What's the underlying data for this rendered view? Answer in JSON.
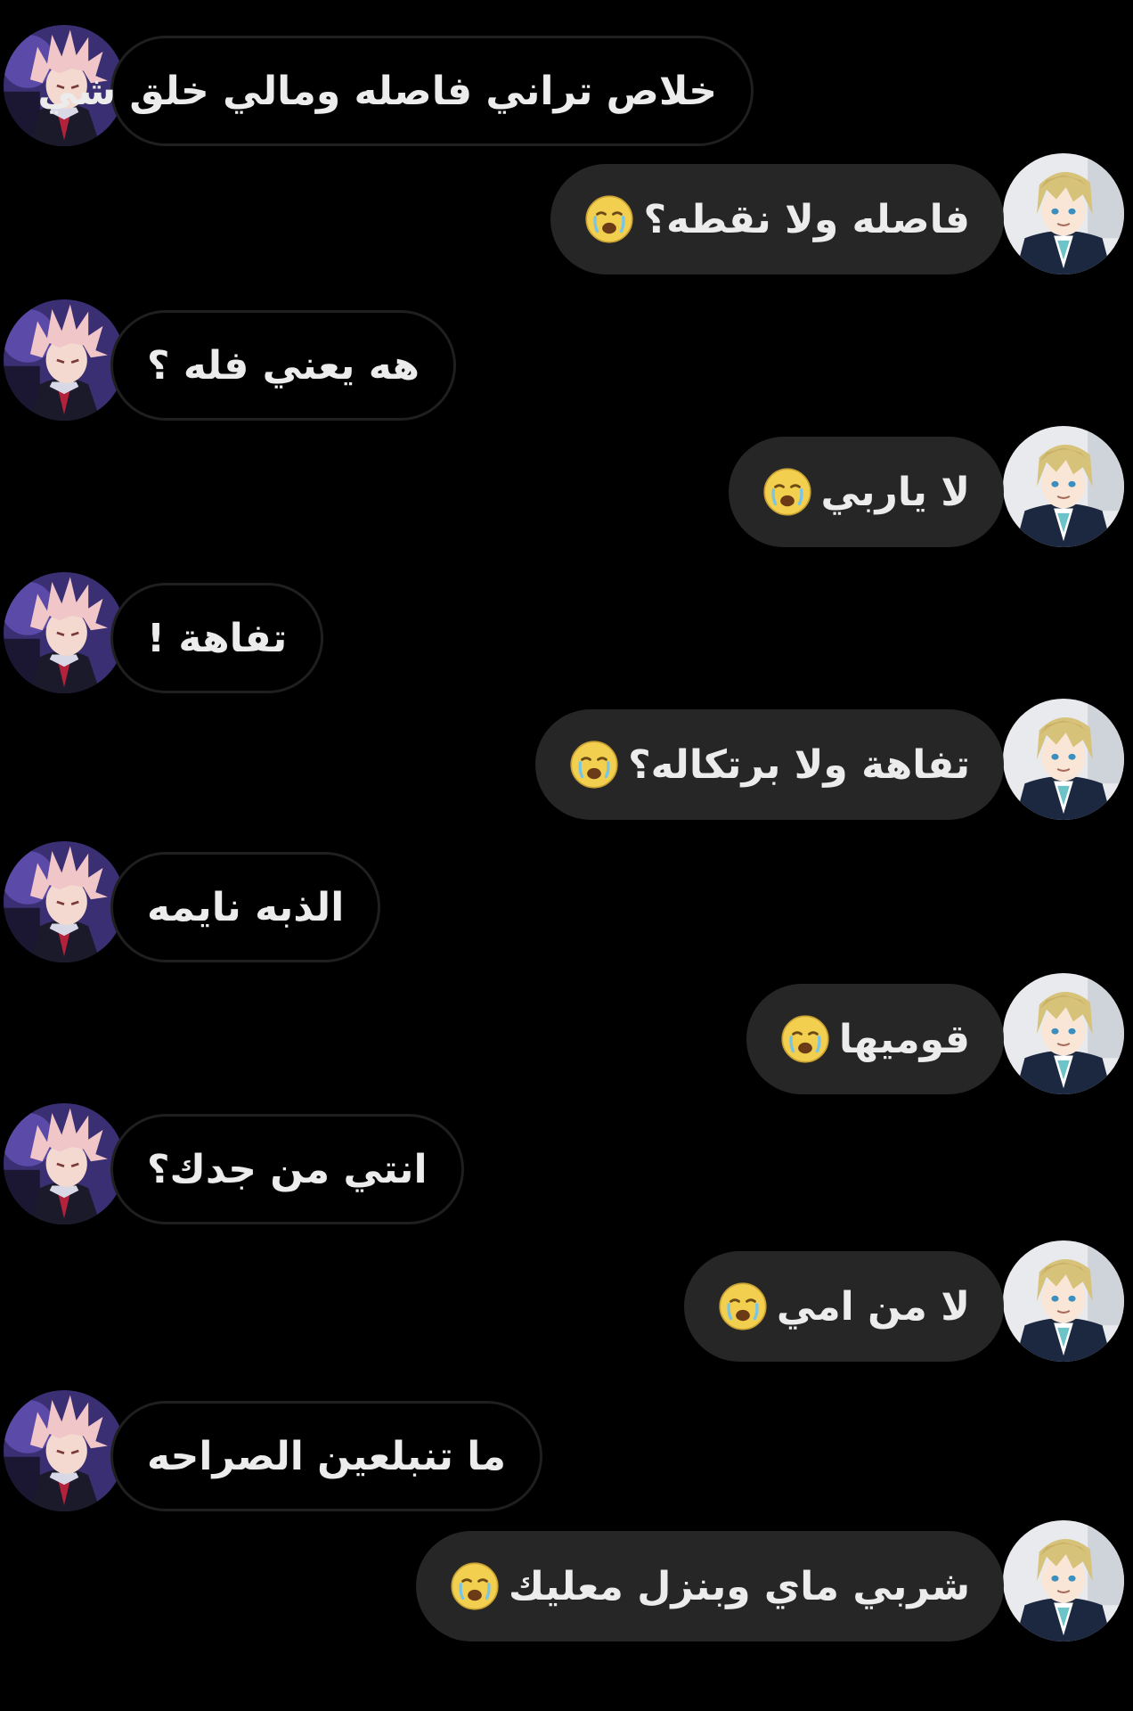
{
  "messages": [
    {
      "side": "in",
      "text": "خلاص تراني فاصله ومالي خلق شي",
      "emoji": null
    },
    {
      "side": "out",
      "text": "فاصله ولا نقطه؟",
      "emoji": "crying-face-emoji"
    },
    {
      "side": "in",
      "text": "هه يعني فله ؟",
      "emoji": null
    },
    {
      "side": "out",
      "text": "لا ياربي",
      "emoji": "crying-face-emoji"
    },
    {
      "side": "in",
      "text": "تفاهة !",
      "emoji": null
    },
    {
      "side": "out",
      "text": "تفاهة ولا برتكاله؟",
      "emoji": "crying-face-emoji"
    },
    {
      "side": "in",
      "text": "الذبه نايمه",
      "emoji": null
    },
    {
      "side": "out",
      "text": "قوميها",
      "emoji": "crying-face-emoji"
    },
    {
      "side": "in",
      "text": "انتي من جدك؟",
      "emoji": null
    },
    {
      "side": "out",
      "text": "لا من امي",
      "emoji": "crying-face-emoji"
    },
    {
      "side": "in",
      "text": "ما تنبلعين الصراحه",
      "emoji": null
    },
    {
      "side": "out",
      "text": "شربي ماي وبنزل معليك",
      "emoji": "crying-face-emoji"
    }
  ],
  "avatars": {
    "incoming": "pink-haired-anime-avatar",
    "outgoing": "blonde-anime-avatar"
  },
  "colors": {
    "background": "#000000",
    "outgoing_bubble": "#262626",
    "incoming_border": "#1f1f1f",
    "text": "#ececec"
  }
}
